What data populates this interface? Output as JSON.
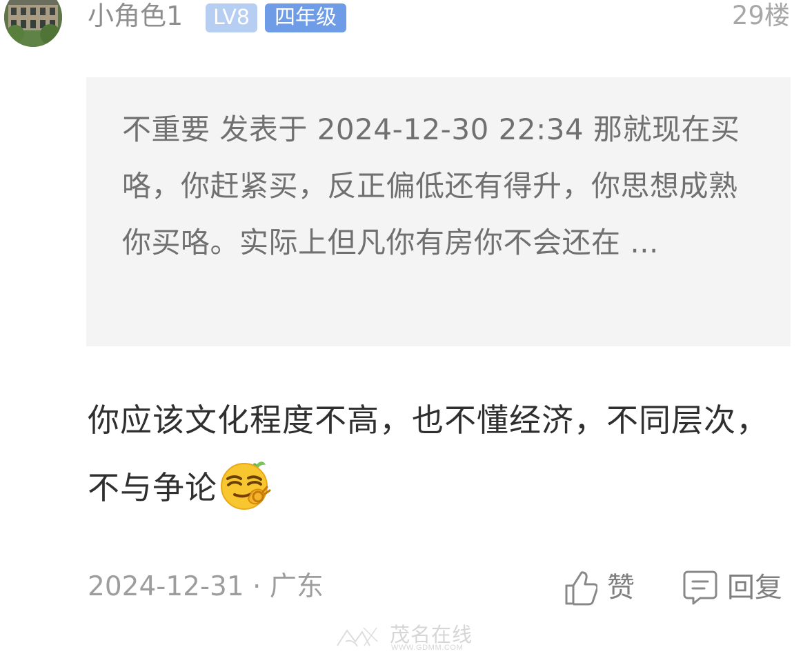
{
  "post": {
    "username": "小角色1",
    "level_badge": "LV8",
    "grade_badge": "四年级",
    "floor": "29楼",
    "quote": "不重要 发表于 2024-12-30 22:34 那就现在买咯，你赶紧买，反正偏低还有得升，你思想成熟你买咯。实际上但凡你有房你不会还在 ...",
    "body": "你应该文化程度不高，也不懂经济，不同层次，不与争论",
    "emoji_icon": "smirk-ok-hand-emoji",
    "date_location": "2024-12-31 · 广东"
  },
  "actions": {
    "like_label": "赞",
    "reply_label": "回复",
    "like_icon": "thumbs-up-icon",
    "reply_icon": "comment-icon"
  },
  "watermark": {
    "main": "茂名在线",
    "sub": "WWW.GDMM.COM"
  },
  "colors": {
    "level_badge": "#b6cef2",
    "grade_badge": "#6f9ce6",
    "quote_background": "#f4f4f4",
    "secondary_text": "#9d9d9d"
  }
}
